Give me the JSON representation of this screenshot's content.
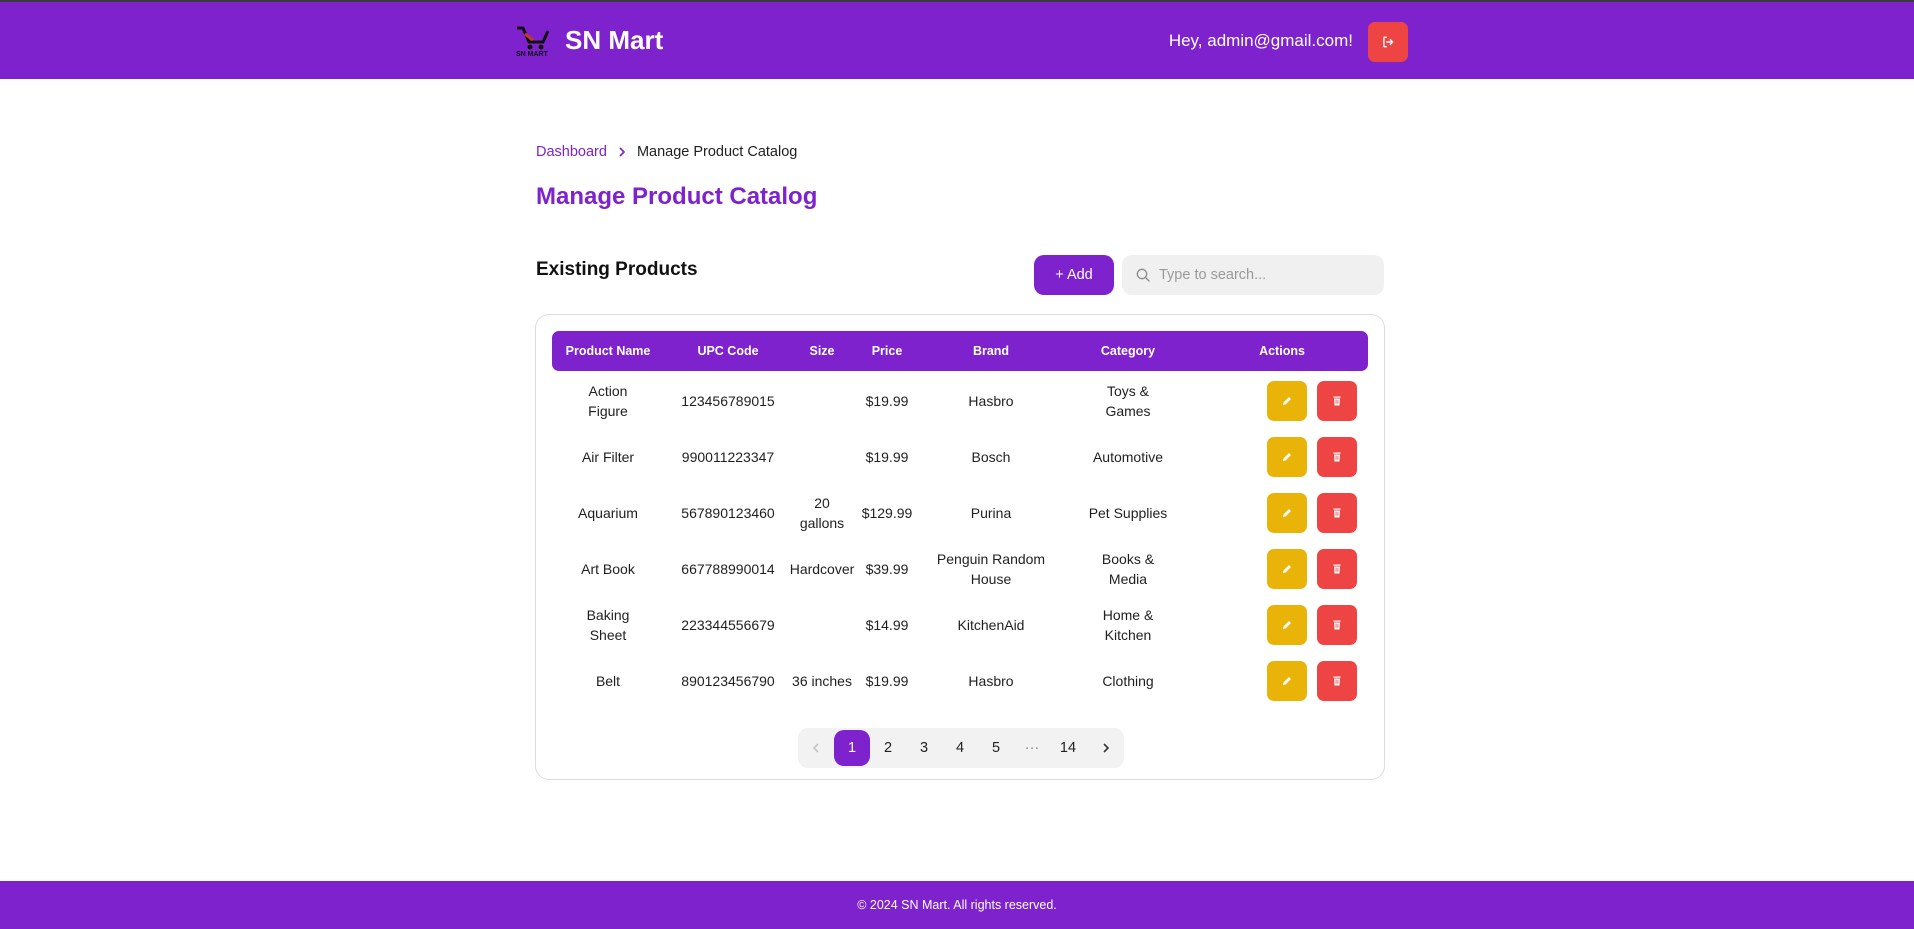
{
  "header": {
    "brand_name": "SN Mart",
    "logo_text": "SN MART",
    "greeting": "Hey, admin@gmail.com!"
  },
  "breadcrumb": {
    "root": "Dashboard",
    "current": "Manage Product Catalog"
  },
  "page_title": "Manage Product Catalog",
  "section": {
    "title": "Existing Products",
    "add_label": "+ Add",
    "search_placeholder": "Type to search..."
  },
  "table": {
    "columns": [
      "Product Name",
      "UPC Code",
      "Size",
      "Price",
      "Brand",
      "Category",
      "Actions"
    ],
    "rows": [
      [
        "Action Figure",
        "123456789015",
        "",
        "$19.99",
        "Hasbro",
        "Toys & Games"
      ],
      [
        "Air Filter",
        "990011223347",
        "",
        "$19.99",
        "Bosch",
        "Automotive"
      ],
      [
        "Aquarium",
        "567890123460",
        "20 gallons",
        "$129.99",
        "Purina",
        "Pet Supplies"
      ],
      [
        "Art Book",
        "667788990014",
        "Hardcover",
        "$39.99",
        "Penguin Random House",
        "Books & Media"
      ],
      [
        "Baking Sheet",
        "223344556679",
        "",
        "$14.99",
        "KitchenAid",
        "Home & Kitchen"
      ],
      [
        "Belt",
        "890123456790",
        "36 inches",
        "$19.99",
        "Hasbro",
        "Clothing"
      ]
    ]
  },
  "pagination": {
    "pages": [
      "1",
      "2",
      "3",
      "4",
      "5",
      "···",
      "14"
    ],
    "current": "1"
  },
  "footer": "© 2024 SN Mart. All rights reserved.",
  "colors": {
    "primary": "#7e22ce",
    "edit": "#eab308",
    "danger": "#ef4444"
  }
}
